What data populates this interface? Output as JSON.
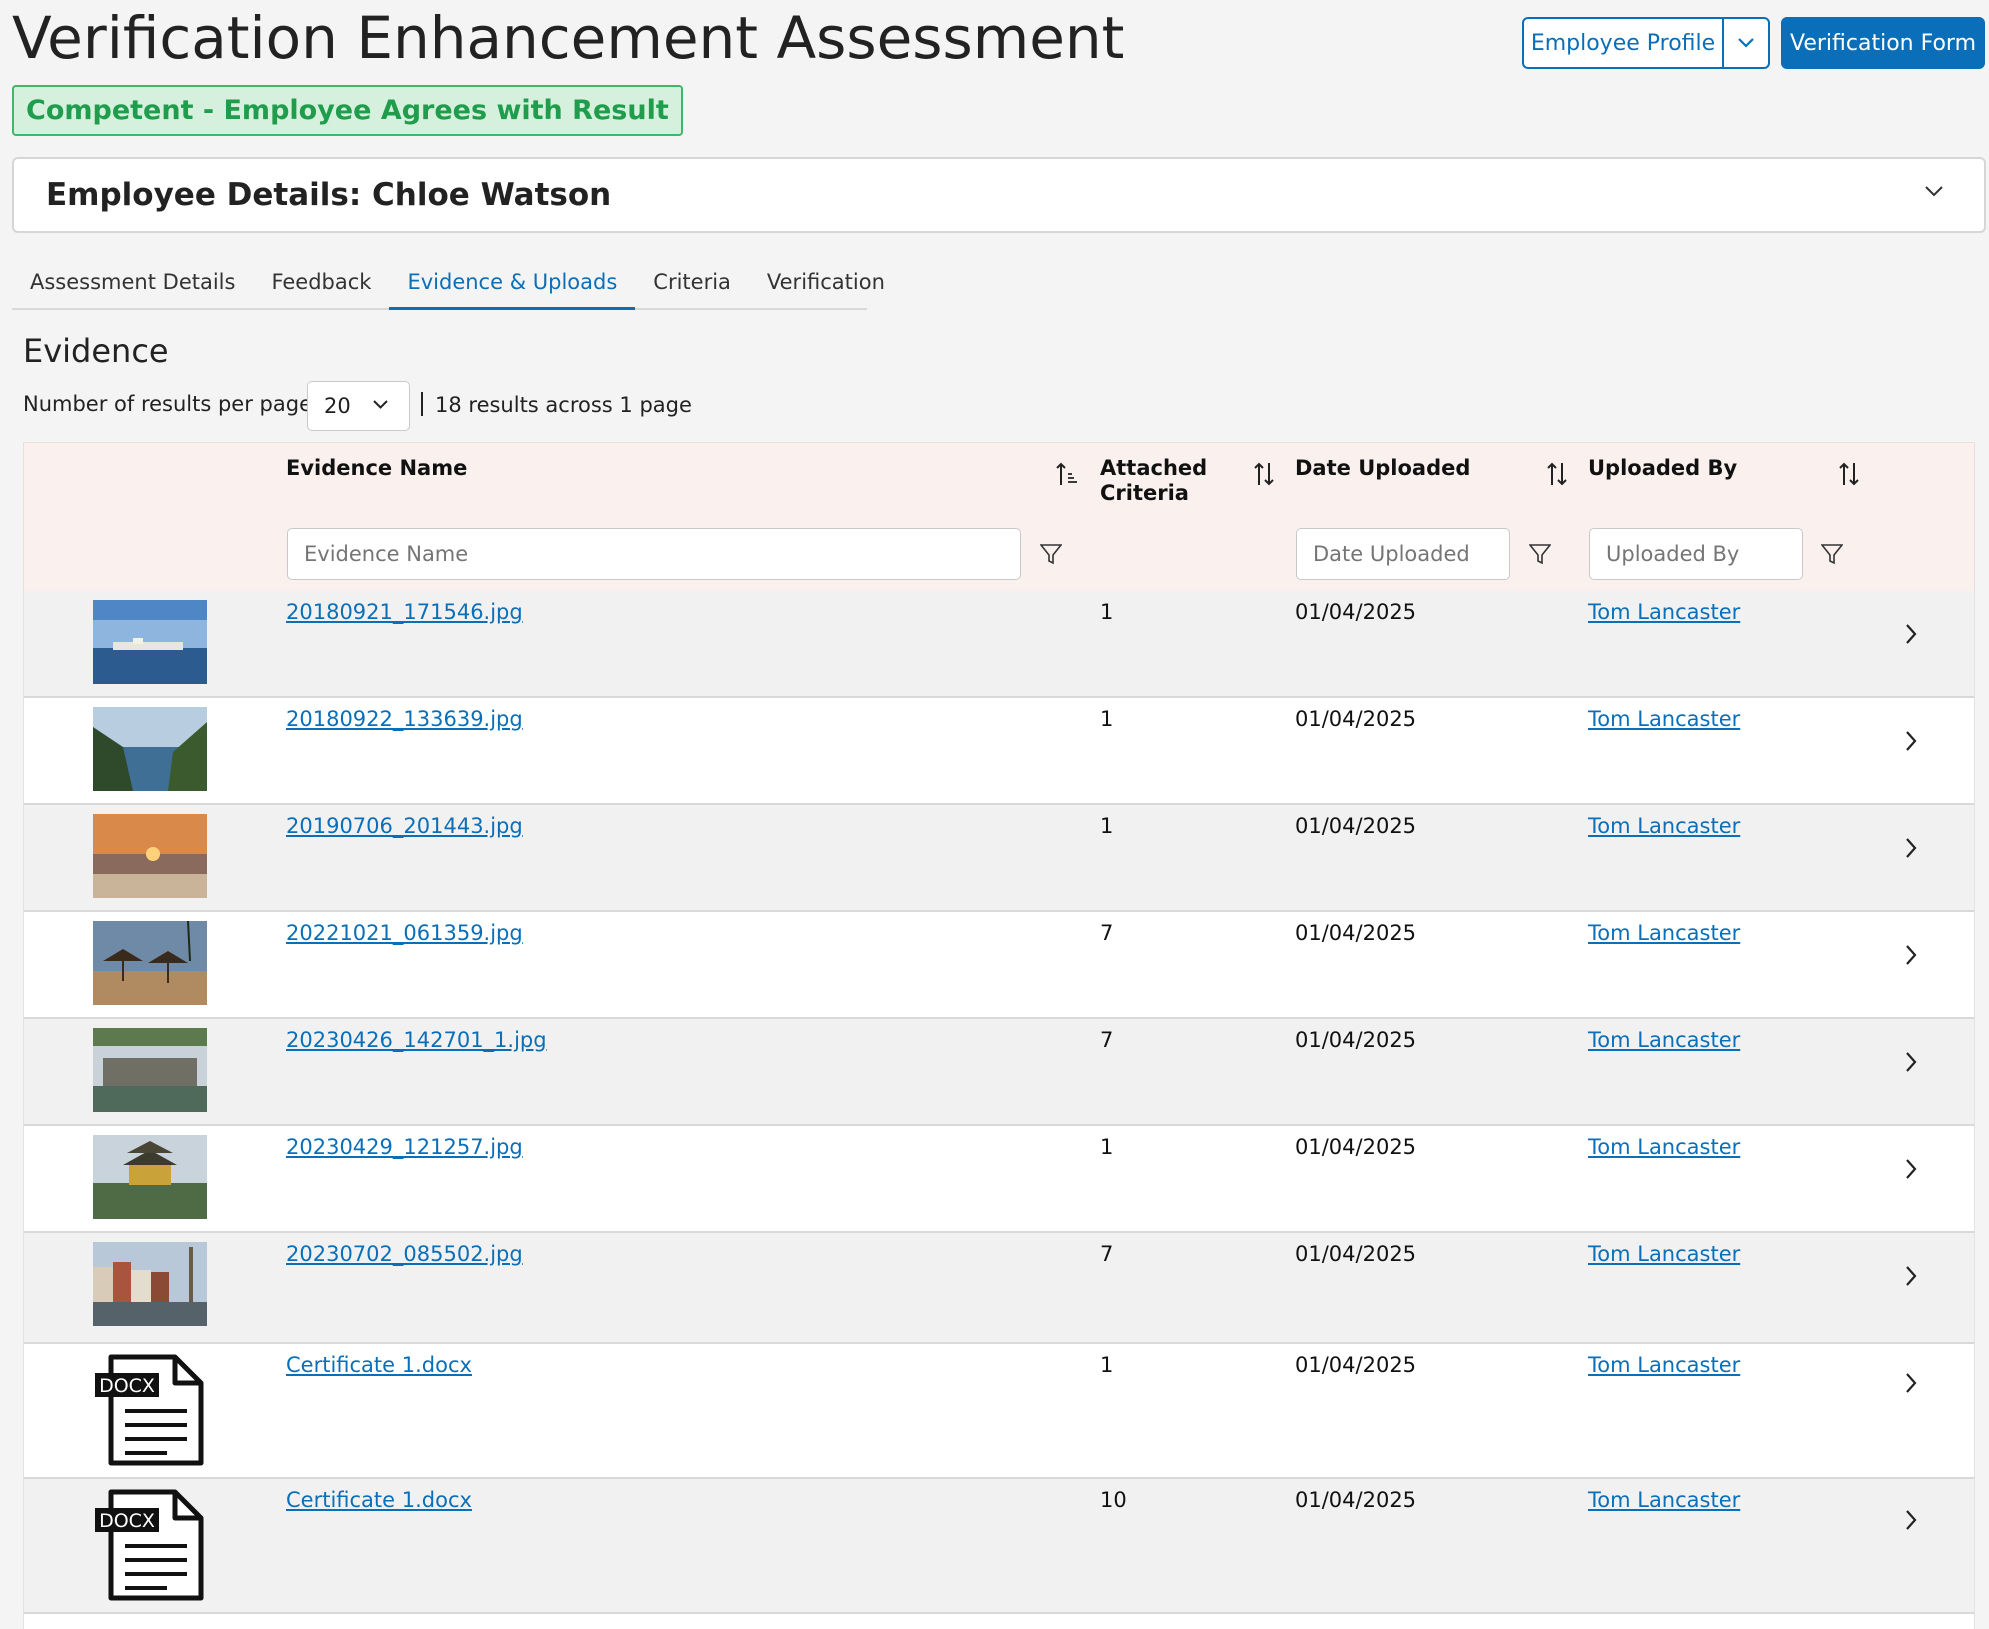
{
  "header": {
    "title": "Verification Enhancement Assessment",
    "status": "Competent - Employee Agrees with Result",
    "profile_button": "Employee Profile",
    "verify_button": "Verification Form"
  },
  "details": {
    "title": "Employee Details: Chloe Watson"
  },
  "tabs": [
    {
      "label": "Assessment Details"
    },
    {
      "label": "Feedback"
    },
    {
      "label": "Evidence & Uploads"
    },
    {
      "label": "Criteria"
    },
    {
      "label": "Verification"
    }
  ],
  "evidence": {
    "title": "Evidence",
    "per_page_label": "Number of results per page",
    "per_page_value": "20",
    "results_info": "18 results across 1 page",
    "columns": {
      "name": "Evidence Name",
      "criteria_line1": "Attached",
      "criteria_line2": "Criteria",
      "date": "Date Uploaded",
      "user": "Uploaded By"
    },
    "filters": {
      "name": "Evidence Name",
      "date": "Date Uploaded",
      "user": "Uploaded By"
    },
    "rows": [
      {
        "name": "20180921_171546.jpg",
        "criteria": "1",
        "date": "01/04/2025",
        "user": "Tom Lancaster"
      },
      {
        "name": "20180922_133639.jpg",
        "criteria": "1",
        "date": "01/04/2025",
        "user": "Tom Lancaster"
      },
      {
        "name": "20190706_201443.jpg",
        "criteria": "1",
        "date": "01/04/2025",
        "user": "Tom Lancaster"
      },
      {
        "name": "20221021_061359.jpg",
        "criteria": "7",
        "date": "01/04/2025",
        "user": "Tom Lancaster"
      },
      {
        "name": "20230426_142701_1.jpg",
        "criteria": "7",
        "date": "01/04/2025",
        "user": "Tom Lancaster"
      },
      {
        "name": "20230429_121257.jpg",
        "criteria": "1",
        "date": "01/04/2025",
        "user": "Tom Lancaster"
      },
      {
        "name": "20230702_085502.jpg",
        "criteria": "7",
        "date": "01/04/2025",
        "user": "Tom Lancaster"
      },
      {
        "name": "Certificate 1.docx",
        "criteria": "1",
        "date": "01/04/2025",
        "user": "Tom Lancaster",
        "file_label": "DOCX"
      },
      {
        "name": "Certificate 1.docx",
        "criteria": "10",
        "date": "01/04/2025",
        "user": "Tom Lancaster",
        "file_label": "DOCX"
      }
    ]
  },
  "colors": {
    "primary": "#0a6fb8",
    "badge_text": "#1f9d4c",
    "badge_bg": "#d5f0dc",
    "header_bg": "#faf1ee"
  }
}
